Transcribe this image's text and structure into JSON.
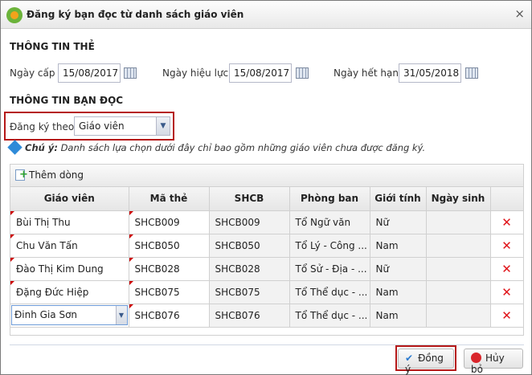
{
  "dialog": {
    "title": "Đăng ký bạn đọc từ danh sách giáo viên",
    "close_icon": "×"
  },
  "card_info": {
    "heading": "THÔNG TIN THẺ",
    "issue_date_label": "Ngày cấp",
    "issue_date": "15/08/2017",
    "effective_date_label": "Ngày hiệu lực",
    "effective_date": "15/08/2017",
    "expiry_date_label": "Ngày hết hạn",
    "expiry_date": "31/05/2018"
  },
  "reader_info": {
    "heading": "THÔNG TIN BẠN ĐỌC",
    "register_by_label": "Đăng ký theo",
    "register_by_value": "Giáo viên"
  },
  "note": {
    "label": "Chú ý:",
    "text": "Danh sách lựa chọn dưới đây chỉ bao gồm những giáo viên chưa được đăng ký."
  },
  "grid": {
    "add_row_label": "Thêm dòng",
    "columns": [
      "Giáo viên",
      "Mã thẻ",
      "SHCB",
      "Phòng ban",
      "Giới tính",
      "Ngày sinh"
    ],
    "rows": [
      {
        "teacher": "Bùi Thị Thu",
        "card": "SHCB009",
        "shcb": "SHCB009",
        "dept": "Tổ Ngữ văn",
        "gender": "Nữ",
        "dob": ""
      },
      {
        "teacher": "Chu Văn Tấn",
        "card": "SHCB050",
        "shcb": "SHCB050",
        "dept": "Tổ Lý - Công ...",
        "gender": "Nam",
        "dob": ""
      },
      {
        "teacher": "Đào Thị Kim Dung",
        "card": "SHCB028",
        "shcb": "SHCB028",
        "dept": "Tổ Sử - Địa - ...",
        "gender": "Nữ",
        "dob": ""
      },
      {
        "teacher": "Đặng Đức Hiệp",
        "card": "SHCB075",
        "shcb": "SHCB075",
        "dept": "Tổ Thể dục - ...",
        "gender": "Nam",
        "dob": ""
      },
      {
        "teacher": "Đinh Gia Sơn",
        "card": "SHCB076",
        "shcb": "SHCB076",
        "dept": "Tổ Thể dục - ...",
        "gender": "Nam",
        "dob": ""
      }
    ],
    "delete_icon": "✕"
  },
  "footer": {
    "ok_label": "Đồng ý",
    "cancel_label": "Hủy bỏ"
  }
}
